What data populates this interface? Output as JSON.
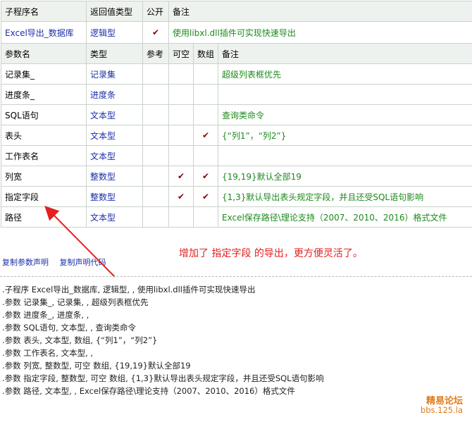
{
  "func_header": {
    "name": "子程序名",
    "return_type": "返回值类型",
    "public": "公开",
    "remark": "备注"
  },
  "func": {
    "name": "Excel导出_数据库",
    "return_type": "逻辑型",
    "public_check": "✔",
    "remark": "使用libxl.dll插件可实现快速导出"
  },
  "param_header": {
    "name": "参数名",
    "type": "类型",
    "ref": "参考",
    "nullable": "可空",
    "array": "数组",
    "remark": "备注"
  },
  "params": [
    {
      "name": "记录集_",
      "type": "记录集",
      "ref": "",
      "nullable": "",
      "array": "",
      "remark": "超级列表框优先"
    },
    {
      "name": "进度条_",
      "type": "进度条",
      "ref": "",
      "nullable": "",
      "array": "",
      "remark": ""
    },
    {
      "name": "SQL语句",
      "type": "文本型",
      "ref": "",
      "nullable": "",
      "array": "",
      "remark": "查询类命令"
    },
    {
      "name": "表头",
      "type": "文本型",
      "ref": "",
      "nullable": "",
      "array": "✔",
      "remark": "{“列1”，“列2”}"
    },
    {
      "name": "工作表名",
      "type": "文本型",
      "ref": "",
      "nullable": "",
      "array": "",
      "remark": ""
    },
    {
      "name": "列宽",
      "type": "整数型",
      "ref": "",
      "nullable": "✔",
      "array": "✔",
      "remark": "{19,19}默认全部19"
    },
    {
      "name": "指定字段",
      "type": "整数型",
      "ref": "",
      "nullable": "✔",
      "array": "✔",
      "remark": "{1,3}默认导出表头规定字段，并且还受SQL语句影响"
    },
    {
      "name": "路径",
      "type": "文本型",
      "ref": "",
      "nullable": "",
      "array": "",
      "remark": "Excel保存路径\\理论支持（2007、2010、2016）格式文件"
    }
  ],
  "links": {
    "copy_params": "复制参数声明",
    "copy_code": "复制声明代码"
  },
  "annotation": "增加了 指定字段 的导出，更方便灵活了。",
  "code_lines": [
    ".子程序 Excel导出_数据库, 逻辑型, , 使用libxl.dll插件可实现快速导出",
    ".参数 记录集_, 记录集, , 超级列表框优先",
    ".参数 进度条_, 进度条, ,",
    ".参数 SQL语句, 文本型, , 查询类命令",
    ".参数 表头, 文本型, 数组, {“列1”，“列2”}",
    ".参数 工作表名, 文本型, ,",
    ".参数 列宽, 整数型, 可空 数组, {19,19}默认全部19",
    ".参数 指定字段, 整数型, 可空 数组, {1,3}默认导出表头规定字段，并且还受SQL语句影响",
    ".参数 路径, 文本型, , Excel保存路径\\理论支持（2007、2010、2016）格式文件"
  ],
  "watermark": {
    "line1": "精易论坛",
    "line2": "bbs.125.la"
  },
  "colors": {
    "type_text": "#1d2fa8",
    "remark_text": "#1c8a1c",
    "check": "#8b0000",
    "annotation": "#e22020",
    "watermark": "#e07a1a"
  }
}
